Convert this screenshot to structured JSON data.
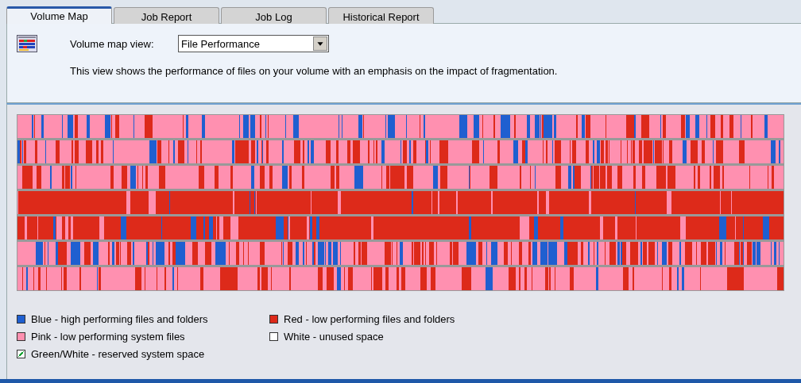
{
  "tabs": [
    {
      "label": "Volume Map",
      "selected": true
    },
    {
      "label": "Job Report",
      "selected": false
    },
    {
      "label": "Job Log",
      "selected": false
    },
    {
      "label": "Historical Report",
      "selected": false
    }
  ],
  "view_selector": {
    "label": "Volume map view:",
    "value": "File Performance"
  },
  "description": "This view shows the performance of files on your volume with an emphasis on the impact of fragmentation.",
  "legend": [
    {
      "label": "Blue - high performing files and folders",
      "color": "#1f5fd0",
      "kind": "solid"
    },
    {
      "label": "Red - low performing files and folders",
      "color": "#dd2a1a",
      "kind": "solid"
    },
    {
      "label": "Pink - low performing system files",
      "color": "#ff90b0",
      "kind": "solid"
    },
    {
      "label": "White - unused space",
      "color": "#ffffff",
      "kind": "solid"
    },
    {
      "label": "Green/White - reserved system space",
      "kind": "hatch"
    }
  ]
}
